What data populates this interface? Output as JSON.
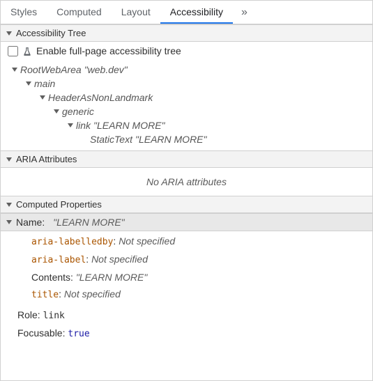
{
  "tabs": {
    "items": [
      "Styles",
      "Computed",
      "Layout",
      "Accessibility"
    ],
    "active_index": 3,
    "overflow_glyph": "»"
  },
  "sections": {
    "tree_title": "Accessibility Tree",
    "aria_title": "ARIA Attributes",
    "computed_title": "Computed Properties"
  },
  "tree_panel": {
    "checkbox_label": "Enable full-page accessibility tree"
  },
  "ax_tree": [
    {
      "depth": 0,
      "role": "RootWebArea",
      "quoted": "\"web.dev\""
    },
    {
      "depth": 1,
      "role": "main"
    },
    {
      "depth": 2,
      "role": "HeaderAsNonLandmark"
    },
    {
      "depth": 3,
      "role": "generic"
    },
    {
      "depth": 4,
      "role": "link",
      "quoted": "\"LEARN MORE\""
    },
    {
      "depth": 5,
      "role": "StaticText",
      "quoted": "\"LEARN MORE\"",
      "leaf": true
    }
  ],
  "aria_empty": "No ARIA attributes",
  "computed": {
    "name_label": "Name:",
    "name_value": "\"LEARN MORE\"",
    "name_sources": [
      {
        "attr": "aria-labelledby",
        "sep": ":",
        "val": "Not specified"
      },
      {
        "attr": "aria-label",
        "sep": ":",
        "val": "Not specified"
      },
      {
        "plain": "Contents",
        "sep": ":",
        "qval": "\"LEARN MORE\""
      },
      {
        "attr": "title",
        "sep": ":",
        "val": "Not specified"
      }
    ],
    "role_label": "Role:",
    "role_value": "link",
    "focusable_label": "Focusable:",
    "focusable_value": "true"
  }
}
